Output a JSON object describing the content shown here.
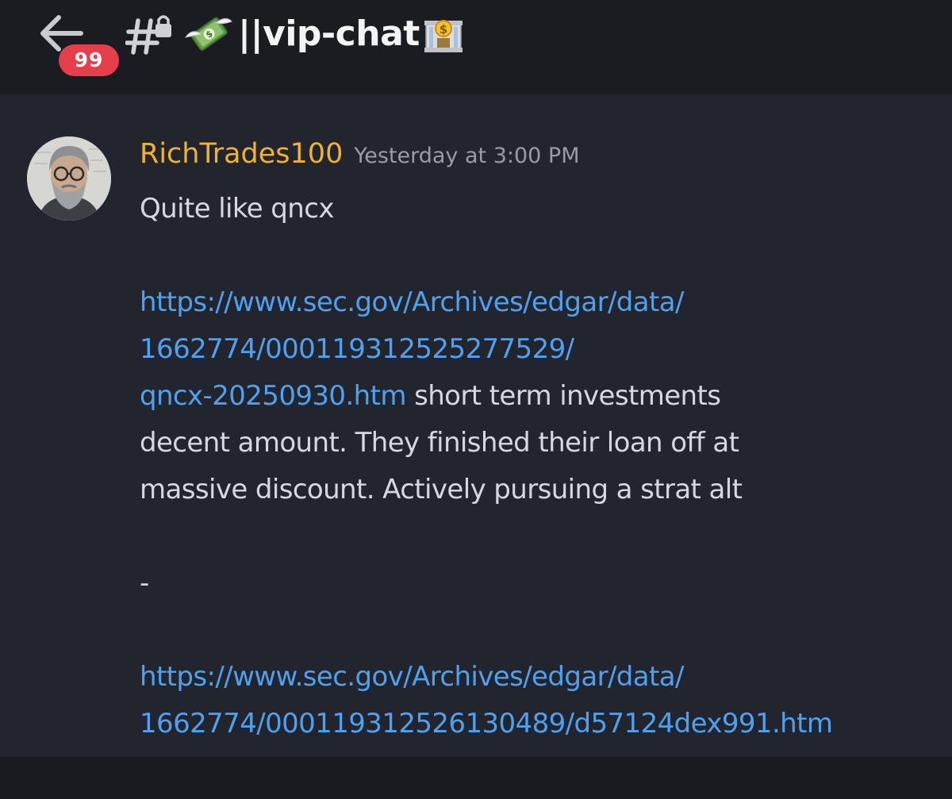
{
  "header": {
    "unread_badge": "99",
    "channel_name": "||vip-chat",
    "icons": {
      "back": "arrow-left-icon",
      "channel_type": "locked-hash-icon",
      "prefix_emoji": "money-with-wings-icon",
      "suffix_emoji": "bank-icon"
    }
  },
  "message": {
    "author": "RichTrades100",
    "timestamp": "Yesterday at 3:00 PM",
    "lines": [
      {
        "text": "Quite like qncx"
      },
      {
        "text": ""
      },
      {
        "link": "https://www.sec.gov/Archives/edgar/data/"
      },
      {
        "link": "1662774/000119312525277529/"
      },
      {
        "link": "qncx-20250930.htm",
        "text": " short term investments"
      },
      {
        "text": "decent amount. They finished their loan off at"
      },
      {
        "text": "massive discount. Actively pursuing a strat alt"
      },
      {
        "text": ""
      },
      {
        "text": "-"
      },
      {
        "text": ""
      },
      {
        "link": "https://www.sec.gov/Archives/edgar/data/"
      },
      {
        "link": "1662774/000119312526130489/d57124dex991.htm"
      }
    ]
  },
  "colors": {
    "header_bg": "#1b1c21",
    "message_bg": "#22242e",
    "username": "#f0b232",
    "link": "#4fa1f0",
    "body_text": "#d6d8de",
    "timestamp": "#9a9ca5",
    "badge": "#e5404a"
  }
}
